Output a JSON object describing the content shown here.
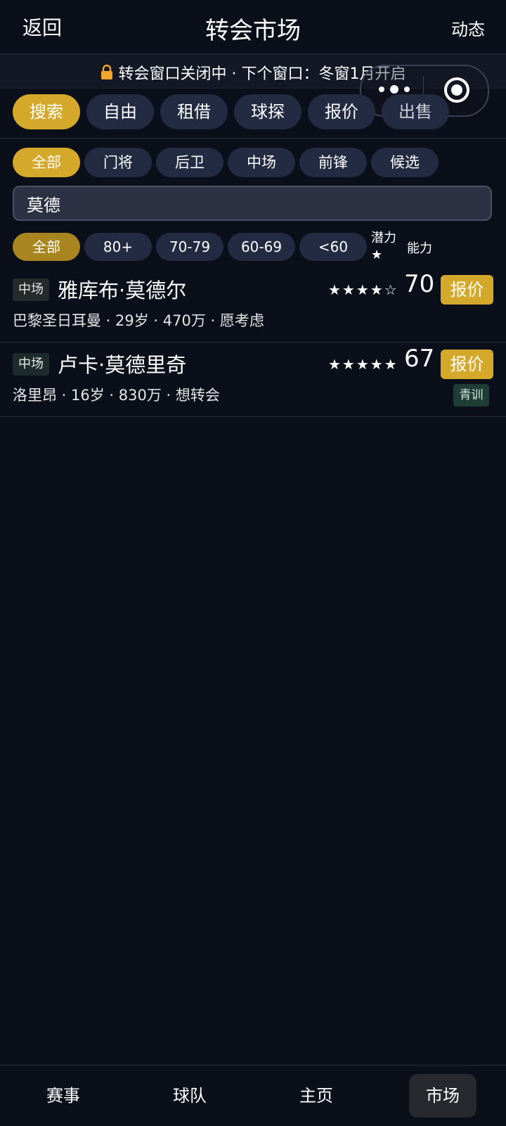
{
  "header": {
    "back_label": "返回",
    "title": "转会市场",
    "feed_label": "动态"
  },
  "banner": {
    "text": "转会窗口关闭中 · 下个窗口：冬窗1月开启",
    "lock_color": "#f2a62f"
  },
  "tabs": [
    {
      "label": "搜索",
      "active": true
    },
    {
      "label": "自由",
      "active": false
    },
    {
      "label": "租借",
      "active": false
    },
    {
      "label": "球探",
      "active": false
    },
    {
      "label": "报价",
      "active": false
    },
    {
      "label": "出售",
      "active": false
    }
  ],
  "positions": [
    {
      "label": "全部",
      "active": true
    },
    {
      "label": "门将",
      "active": false
    },
    {
      "label": "后卫",
      "active": false
    },
    {
      "label": "中场",
      "active": false
    },
    {
      "label": "前锋",
      "active": false
    },
    {
      "label": "候选",
      "active": false
    }
  ],
  "search": {
    "value": "莫德",
    "placeholder": ""
  },
  "ratings": [
    {
      "label": "全部",
      "active": true
    },
    {
      "label": "80+",
      "active": false
    },
    {
      "label": "70-79",
      "active": false
    },
    {
      "label": "60-69",
      "active": false
    },
    {
      "label": "<60",
      "active": false
    }
  ],
  "sort": {
    "potential_label": "潜力★",
    "ability_label": "能力"
  },
  "players": [
    {
      "position": "中场",
      "name": "雅库布·莫德尔",
      "stars": "★★★★☆",
      "stars_value": 4,
      "rating": "70",
      "offer_label": "报价",
      "meta": "巴黎圣日耳曼 · 29岁 · 470万 · 愿考虑",
      "badge": ""
    },
    {
      "position": "中场",
      "name": "卢卡·莫德里奇",
      "stars": "★★★★★",
      "stars_value": 5,
      "rating": "67",
      "offer_label": "报价",
      "meta": "洛里昂 · 16岁 · 830万 · 想转会",
      "badge": "青训"
    }
  ],
  "bottom_nav": [
    {
      "label": "赛事",
      "active": false
    },
    {
      "label": "球队",
      "active": false
    },
    {
      "label": "主页",
      "active": false
    },
    {
      "label": "市场",
      "active": true
    }
  ],
  "colors": {
    "background": "#0b0f19",
    "accent": "#d4a82a",
    "pill": "#232b43"
  }
}
